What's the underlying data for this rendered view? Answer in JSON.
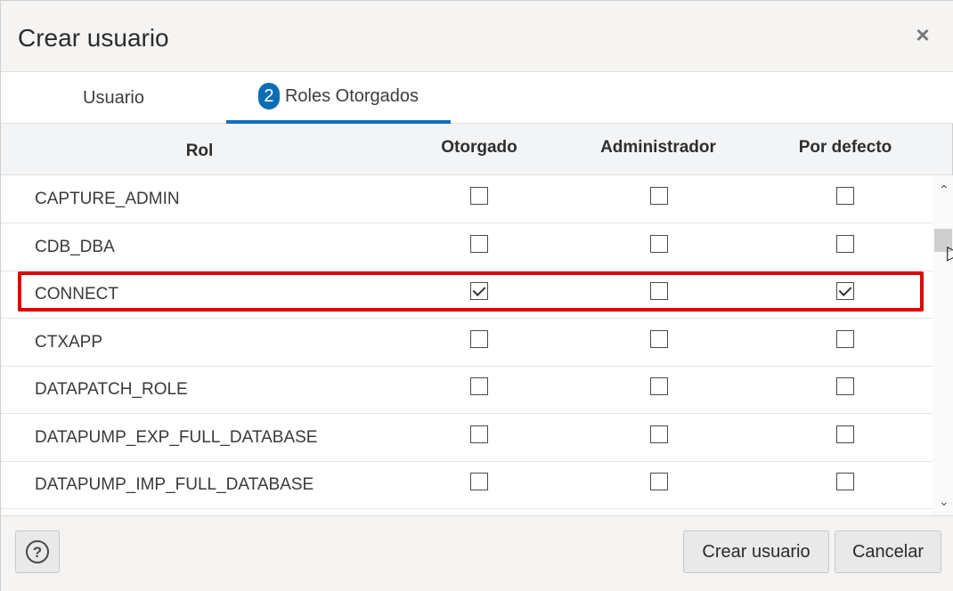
{
  "dialog": {
    "title": "Crear usuario",
    "close_glyph": "×"
  },
  "tabs": [
    {
      "label": "Usuario",
      "badge": ""
    },
    {
      "label": "Roles Otorgados",
      "badge": "2"
    }
  ],
  "table": {
    "columns": [
      "Rol",
      "Otorgado",
      "Administrador",
      "Por defecto"
    ],
    "rows": [
      {
        "rol": "CAPTURE_ADMIN",
        "otorgado": false,
        "administrador": false,
        "por_defecto": false
      },
      {
        "rol": "CDB_DBA",
        "otorgado": false,
        "administrador": false,
        "por_defecto": false
      },
      {
        "rol": "CONNECT",
        "otorgado": true,
        "administrador": false,
        "por_defecto": true
      },
      {
        "rol": "CTXAPP",
        "otorgado": false,
        "administrador": false,
        "por_defecto": false
      },
      {
        "rol": "DATAPATCH_ROLE",
        "otorgado": false,
        "administrador": false,
        "por_defecto": false
      },
      {
        "rol": "DATAPUMP_EXP_FULL_DATABASE",
        "otorgado": false,
        "administrador": false,
        "por_defecto": false
      },
      {
        "rol": "DATAPUMP_IMP_FULL_DATABASE",
        "otorgado": false,
        "administrador": false,
        "por_defecto": false
      }
    ]
  },
  "footer": {
    "help_glyph": "?",
    "create_label": "Crear usuario",
    "cancel_label": "Cancelar"
  },
  "colors": {
    "accent": "#1070c0",
    "highlight": "#e00000"
  }
}
